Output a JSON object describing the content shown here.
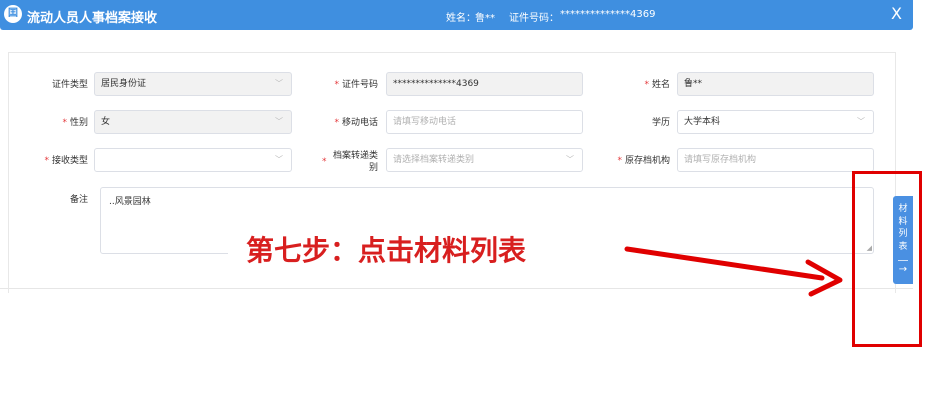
{
  "header": {
    "logo_glyph": "囯",
    "title": "流动人员人事档案接收",
    "name_label": "姓名：",
    "name_value": "鲁**",
    "id_label": "证件号码：",
    "id_value": "**************4369",
    "close": "X"
  },
  "form": {
    "id_type": {
      "label": "证件类型",
      "value": "居民身份证"
    },
    "id_number": {
      "label": "证件号码",
      "value": "**************4369"
    },
    "name": {
      "label": "姓名",
      "value": "鲁**"
    },
    "gender": {
      "label": "性别",
      "value": "女"
    },
    "mobile": {
      "label": "移动电话",
      "placeholder": "请填写移动电话"
    },
    "education": {
      "label": "学历",
      "value": "大学本科"
    },
    "receive_type": {
      "label": "接收类型",
      "value": ""
    },
    "transfer_type": {
      "label_line1": "档案转递类",
      "label_line2": "别",
      "placeholder": "请选择档案转递类别"
    },
    "origin_org": {
      "label": "原存档机构",
      "placeholder": "请填写原存档机构"
    },
    "remark": {
      "label": "备注",
      "value": "..风景园林"
    }
  },
  "annotation": {
    "text": "第七步：点击材料列表",
    "color": "#d81f1f"
  },
  "side_tab": {
    "chars": [
      "材",
      "料",
      "列",
      "表"
    ],
    "arrow": "→"
  },
  "colors": {
    "header": "#3f8fe0",
    "required": "#e4393c",
    "highlight": "#e00000"
  }
}
